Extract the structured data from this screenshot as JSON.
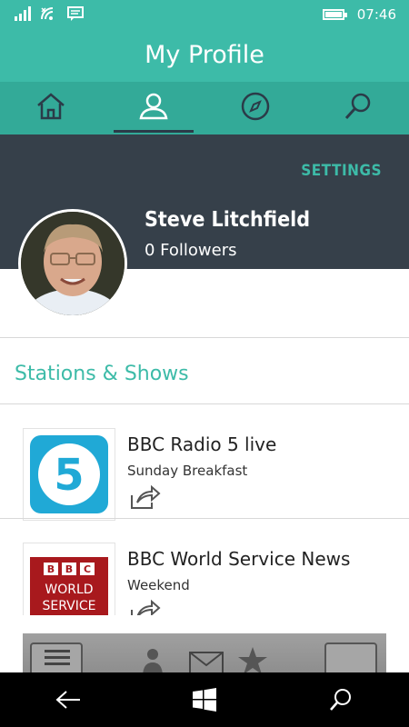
{
  "status_bar": {
    "time": "07:46",
    "icons": [
      "signal-icon",
      "wifi-icon",
      "message-icon",
      "battery-icon"
    ]
  },
  "header": {
    "title": "My Profile"
  },
  "nav_tabs": [
    {
      "name": "home",
      "icon": "home-icon",
      "active": false
    },
    {
      "name": "profile",
      "icon": "profile-icon",
      "active": true
    },
    {
      "name": "explore",
      "icon": "compass-icon",
      "active": false
    },
    {
      "name": "search",
      "icon": "search-icon",
      "active": false
    }
  ],
  "profile": {
    "settings_label": "SETTINGS",
    "name": "Steve Litchfield",
    "followers": "0 Followers"
  },
  "section": {
    "title": "Stations & Shows"
  },
  "stations": [
    {
      "title": "BBC Radio 5 live",
      "subtitle": "Sunday Breakfast",
      "logo": "bbc-5-live-logo",
      "logo_text": "5"
    },
    {
      "title": "BBC World Service News",
      "subtitle": "Weekend",
      "logo": "bbc-world-service-logo",
      "logo_text": "BBC WORLD SERVICE"
    }
  ],
  "colors": {
    "accent": "#3dbba8",
    "dark_header": "#36404a",
    "nav_bg": "#33aa98"
  },
  "system_nav": [
    "back-icon",
    "windows-icon",
    "search-icon"
  ]
}
